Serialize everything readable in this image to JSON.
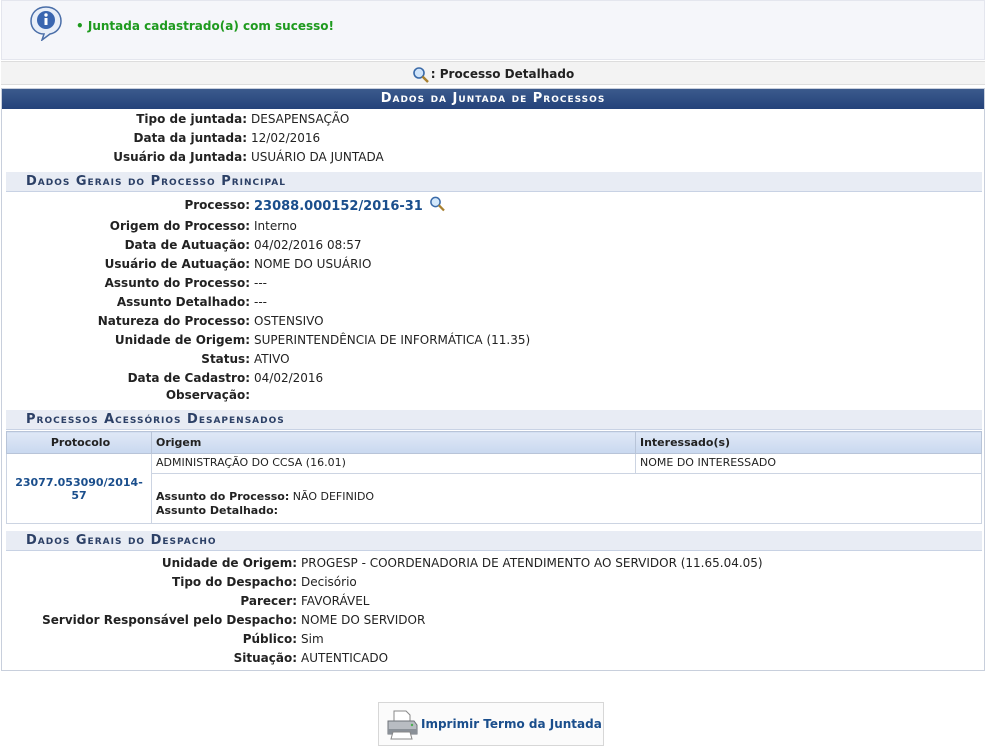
{
  "message": {
    "text": "Juntada cadastrado(a) com sucesso!"
  },
  "legend": {
    "label": ": Processo Detalhado"
  },
  "caption": "Dados da Juntada de Processos",
  "juntada": [
    {
      "label": "Tipo de juntada:",
      "value": "DESAPENSAÇÃO"
    },
    {
      "label": "Data da juntada:",
      "value": "12/02/2016"
    },
    {
      "label": "Usuário da Juntada:",
      "value": "USUÁRIO DA JUNTADA"
    }
  ],
  "principal": {
    "title": "Dados Gerais do Processo Principal",
    "processo_label": "Processo:",
    "processo_number": "23088.000152/2016-31",
    "fields": [
      {
        "label": "Origem do Processo:",
        "value": "Interno"
      },
      {
        "label": "Data de Autuação:",
        "value": "04/02/2016 08:57"
      },
      {
        "label": "Usuário de Autuação:",
        "value": "NOME DO USUÁRIO"
      },
      {
        "label": "Assunto do Processo:",
        "value": "---"
      },
      {
        "label": "Assunto Detalhado:",
        "value": "---"
      },
      {
        "label": "Natureza do Processo:",
        "value": "OSTENSIVO"
      },
      {
        "label": "Unidade de Origem:",
        "value": "SUPERINTENDÊNCIA DE INFORMÁTICA (11.35)"
      },
      {
        "label": "Status:",
        "value": "ATIVO"
      },
      {
        "label": "Data de Cadastro:",
        "value": "04/02/2016"
      },
      {
        "label": "Observação:",
        "value": ""
      }
    ]
  },
  "acessorios": {
    "title": "Processos Acessórios Desapensados",
    "headers": [
      "Protocolo",
      "Origem",
      "Interessado(s)"
    ],
    "row": {
      "protocolo": "23077.053090/2014-57",
      "origem": "ADMINISTRAÇÃO DO CCSA (16.01)",
      "interessado": "NOME DO INTERESSADO",
      "assunto_label": "Assunto do Processo:",
      "assunto_value": "NÃO DEFINIDO",
      "detalhado_label": "Assunto Detalhado:"
    }
  },
  "despacho": {
    "title": "Dados Gerais do Despacho",
    "fields": [
      {
        "label": "Unidade de Origem:",
        "value": "PROGESP - COORDENADORIA DE ATENDIMENTO AO SERVIDOR (11.65.04.05)"
      },
      {
        "label": "Tipo do Despacho:",
        "value": "Decisório"
      },
      {
        "label": "Parecer:",
        "value": "FAVORÁVEL"
      },
      {
        "label": "Servidor Responsável pelo Despacho:",
        "value": "NOME DO SERVIDOR"
      },
      {
        "label": "Público:",
        "value": "Sim"
      },
      {
        "label": "Situação:",
        "value": "AUTENTICADO"
      }
    ]
  },
  "print_button": {
    "label": "Imprimir Termo da Juntada"
  },
  "colors": {
    "header_blue": "#24427a",
    "success_green": "#1e9a1e",
    "link_blue": "#1a4e8c"
  }
}
